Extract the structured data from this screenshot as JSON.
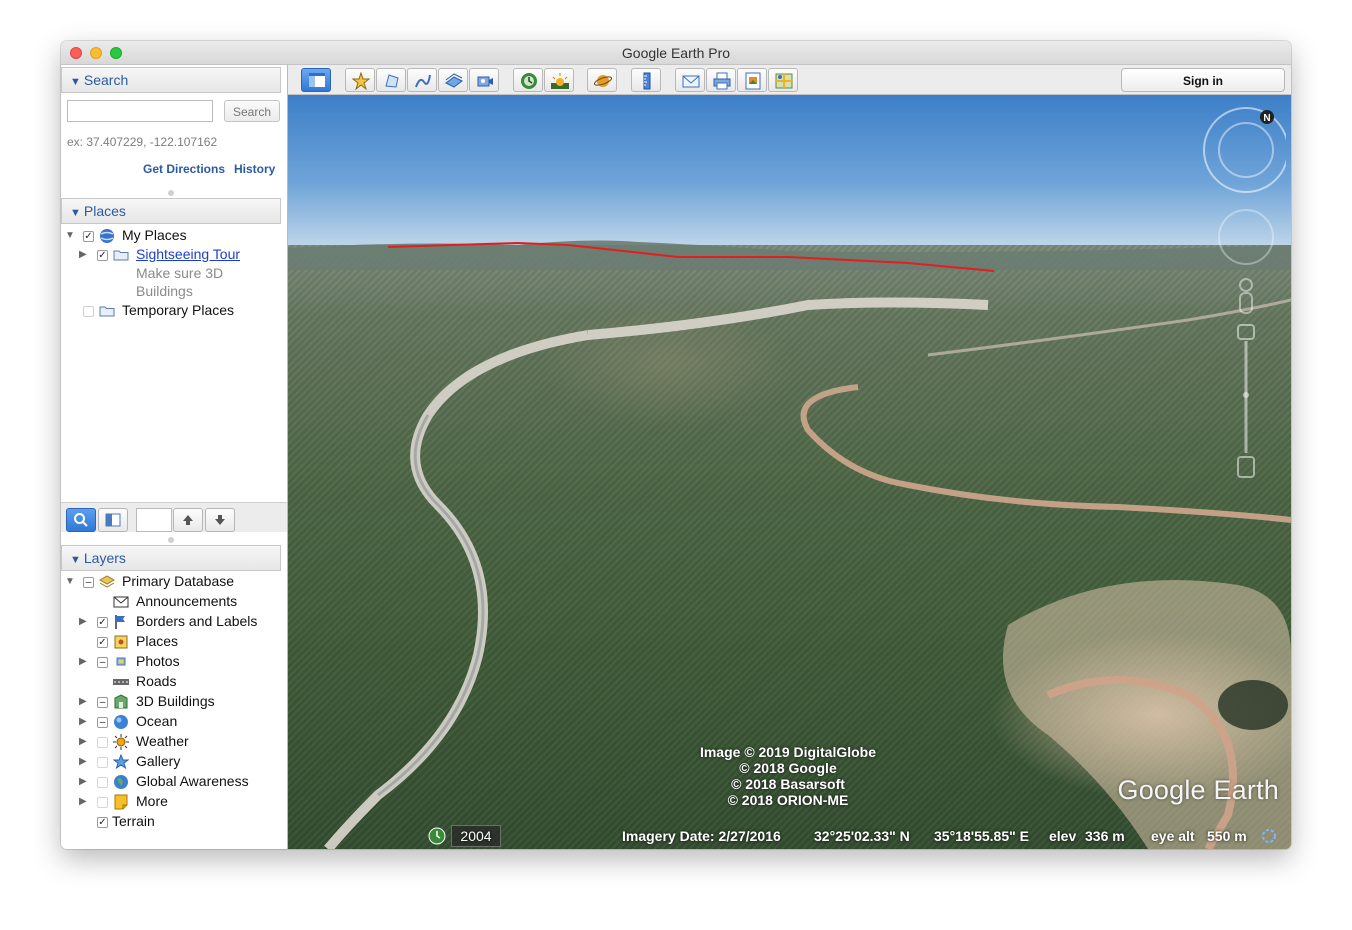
{
  "window": {
    "title": "Google Earth Pro"
  },
  "search": {
    "header": "Search",
    "button": "Search",
    "hint": "ex: 37.407229, -122.107162",
    "get_directions": "Get Directions",
    "history": "History"
  },
  "places": {
    "header": "Places",
    "items": [
      {
        "label": "My Places"
      },
      {
        "label": "Sightseeing Tour",
        "note": [
          "Make sure 3D",
          "Buildings"
        ]
      },
      {
        "label": "Temporary Places"
      }
    ]
  },
  "layers": {
    "header": "Layers",
    "items": [
      {
        "label": "Primary Database"
      },
      {
        "label": "Announcements"
      },
      {
        "label": "Borders and Labels"
      },
      {
        "label": "Places"
      },
      {
        "label": "Photos"
      },
      {
        "label": "Roads"
      },
      {
        "label": "3D Buildings"
      },
      {
        "label": "Ocean"
      },
      {
        "label": "Weather"
      },
      {
        "label": "Gallery"
      },
      {
        "label": "Global Awareness"
      },
      {
        "label": "More"
      },
      {
        "label": "Terrain"
      }
    ]
  },
  "toolbar": {
    "sign_in": "Sign in"
  },
  "view": {
    "attribution": [
      "Image © 2019 DigitalGlobe",
      "© 2018 Google",
      "© 2018 Basarsoft",
      "© 2018 ORION-ME"
    ],
    "logo": "Google Earth",
    "year": "2004",
    "imagery_date": "Imagery Date: 2/27/2016",
    "latitude": "32°25'02.33\" N",
    "longitude": "35°18'55.85\" E",
    "elev_label": "elev",
    "elev_value": "336 m",
    "eye_alt_label": "eye alt",
    "eye_alt_value": "550 m"
  },
  "colors": {
    "accent": "#2c5aa0",
    "link": "#1a3fcf",
    "path_line": "#e02020"
  }
}
